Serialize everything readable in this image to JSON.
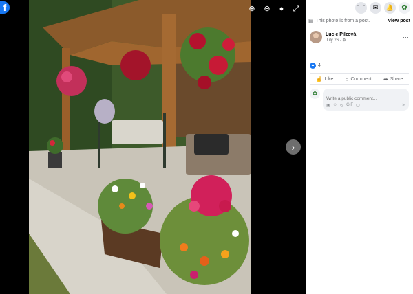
{
  "viewer": {
    "logo_letter": "f",
    "tools": {
      "zoom_in": "⊕",
      "zoom_out": "⊖",
      "tag": "●",
      "fullscreen": "⤢"
    },
    "next_arrow": "›"
  },
  "topbar": {
    "menu_icon": "⋮⋮",
    "messenger_icon": "✉",
    "notifications_icon": "🔔",
    "profile_icon": "✿"
  },
  "notice": {
    "icon": "▤",
    "text": "This photo is from a post.",
    "view_post": "View post"
  },
  "post": {
    "author_name": "Lucie Pilzová",
    "date": "July 26 · ⊕",
    "more": "···"
  },
  "reactions": {
    "like_icon": "👍",
    "count": "4"
  },
  "actions": {
    "like": "Like",
    "comment": "Comment",
    "share": "Share"
  },
  "comment_box": {
    "placeholder": "Write a public comment...",
    "avatar": "✿",
    "tools": [
      "▣",
      "☺",
      "◎",
      "GIF",
      "▢"
    ],
    "send": "➤"
  },
  "colors": {
    "brand": "#1877f2",
    "panel_bg": "#ffffff",
    "viewer_bg": "#000000"
  }
}
